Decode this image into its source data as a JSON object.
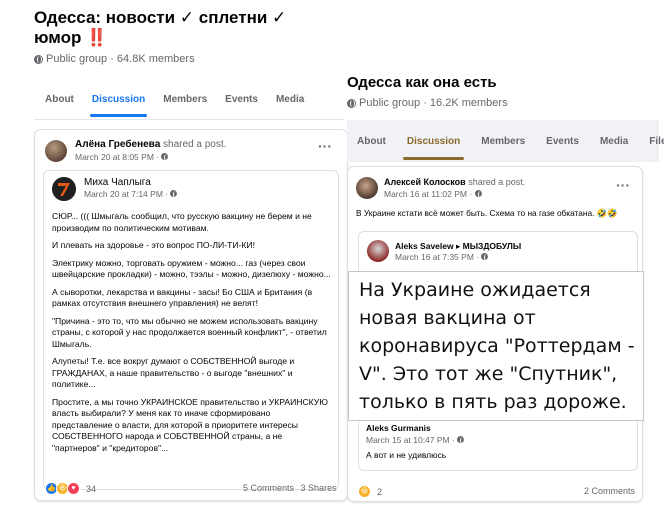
{
  "left": {
    "title": "Одесса: новости ✓ сплетни ✓ юмор ‼️",
    "meta": "Public group · 64.8K members",
    "tabs": [
      "About",
      "Discussion",
      "Members",
      "Events",
      "Media"
    ],
    "post": {
      "author": "Алёна Гребенева",
      "shared": "shared a post.",
      "date": "March 20 at 8:05 PM · ",
      "menu": "···",
      "shared_post": {
        "author": "Миха Чаплыга",
        "date": "March 20 at 7:14 PM · ",
        "paragraphs": [
          "СЮР... ((( Шмыгаль сообщил, что русскую вакцину не берем и не производим по политическим мотивам.",
          "И плевать на здоровье - это вопрос ПО-ЛИ-ТИ-КИ!",
          "Электрику можно, торговать оружием - можно... газ (через свои швейцарские прокладки) - можно, тээлы - можно, дизелюху - можно...",
          "А сыворотки, лекарства и вакцины - засы! Бо США и Британия (в рамках отсутствия внешнего управления) не велят!",
          "\"Причина - это то, что мы обычно не можем использовать вакцину страны, с которой у нас продолжается военный конфликт\", - ответил Шмыгаль.",
          "Алупеты! Т.е. все вокруг думают о СОБСТВЕННОЙ выгоде и ГРАЖДАНАХ, а наше правительство - о выгоде \"внешних\" и политике...",
          "Простите, а мы точно УКРАИНСКОЕ правительство и УКРАИНСКУЮ власть выбирали? У меня как то иначе сформировано представление о власти, для которой в приоритете интересы СОБСТВЕННОГО народа и СОБСТВЕННОЙ страны, а не \"партнеров\" и \"кредиторов\"..."
        ]
      },
      "reactions_count": "34",
      "comments": "5 Comments",
      "shares": "3 Shares"
    }
  },
  "right": {
    "title": "Одесса как она есть",
    "meta": "Public group · 16.2K members",
    "tabs": [
      "About",
      "Discussion",
      "Members",
      "Events",
      "Media",
      "Files"
    ],
    "post": {
      "author": "Алексей Колосков",
      "shared": "shared a post.",
      "date": "March 16 at 11:02 PM · ",
      "menu": "···",
      "text": "В Украине кстати всё может быть. Схема то на газе обкатана. 🤣🤣",
      "shared_post": {
        "author": "Aleks Savelew",
        "arrow": "▸",
        "group": "МЫЗДОБУЛЫ",
        "date": "March 16 at 7:35 PM · "
      },
      "image_text": "На Украине ожидается новая вакцина от коронавируса \"Роттердам - V\". Это тот же \"Спутник\", только в пять раз дороже.",
      "comment": {
        "author": "Aleks Gurmanis",
        "date": "March 15 at 10:47 PM · ",
        "text": "А вот и не удивлюсь"
      },
      "reactions_count": "2",
      "comments": "2 Comments"
    }
  },
  "colors": {
    "accent_blue": "#1877f2",
    "accent_brown": "#8a6a2e",
    "meta_grey": "#65676b"
  }
}
